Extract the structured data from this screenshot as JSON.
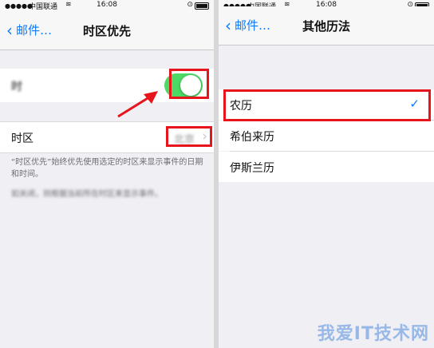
{
  "left": {
    "status": {
      "carrier": "中国联通",
      "time": "16:08"
    },
    "nav": {
      "back_label": "邮件…",
      "title": "时区优先"
    },
    "toggle_row": {
      "label": "时",
      "on": true
    },
    "timezone_row": {
      "label": "时区",
      "value": "北京"
    },
    "footnotes": [
      "“时区优先”始终优先使用选定的时区来显示事件的日期和时间。",
      "如关闭，则根据当前所在时区来显示事件。"
    ]
  },
  "right": {
    "status": {
      "carrier": "中国联通",
      "time": "16:08"
    },
    "nav": {
      "back_label": "邮件…",
      "title": "其他历法"
    },
    "options": [
      {
        "label": "农历",
        "selected": true
      },
      {
        "label": "希伯来历",
        "selected": false
      },
      {
        "label": "伊斯兰历",
        "selected": false
      }
    ]
  },
  "watermark": "我爱IT技术网"
}
